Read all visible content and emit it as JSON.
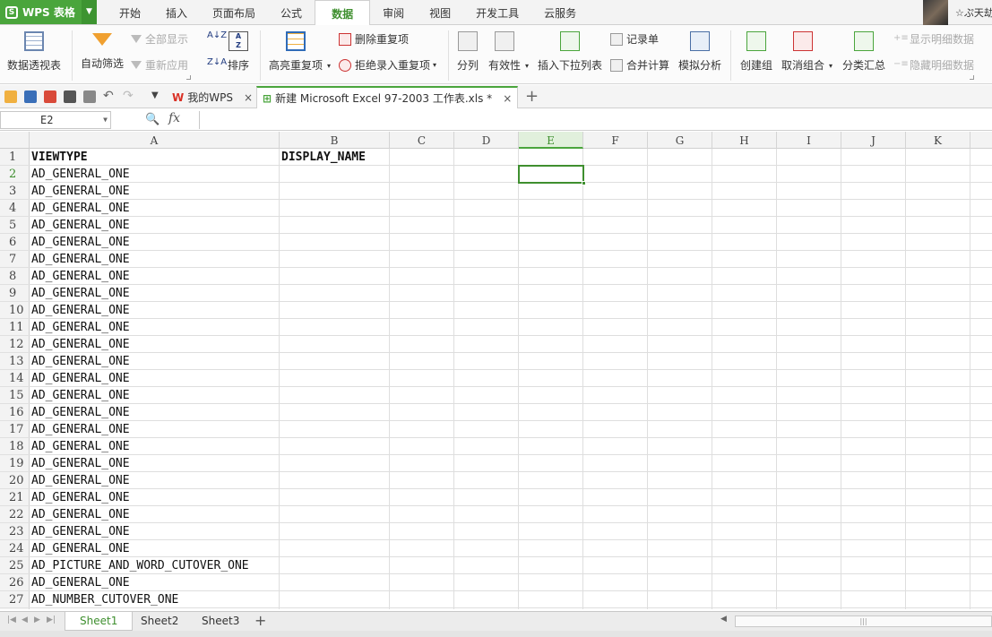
{
  "app": {
    "name": "WPS 表格",
    "logo": "S"
  },
  "menu": {
    "tabs": [
      "开始",
      "插入",
      "页面布局",
      "公式",
      "数据",
      "审阅",
      "视图",
      "开发工具",
      "云服务"
    ],
    "active": "数据"
  },
  "user": {
    "name": "☆ぷ天劫"
  },
  "ribbon": {
    "pivot": "数据透视表",
    "auto_filter": "自动筛选",
    "show_all": "全部显示",
    "reapply": "重新应用",
    "sort": "排序",
    "highlight_dup": "高亮重复项",
    "delete_dup": "删除重复项",
    "reject_dup": "拒绝录入重复项",
    "split": "分列",
    "validity": "有效性",
    "insert_dropdown": "插入下拉列表",
    "record_form": "记录单",
    "consolidate": "合并计算",
    "simulate": "模拟分析",
    "create_group": "创建组",
    "ungroup": "取消组合",
    "subtotal": "分类汇总",
    "show_detail": "显示明细数据",
    "hide_detail": "隐藏明细数据"
  },
  "doc_tabs": [
    {
      "label": "我的WPS"
    },
    {
      "label": "新建 Microsoft Excel 97-2003 工作表.xls *"
    }
  ],
  "formula_bar": {
    "cell_ref": "E2",
    "fx": "fx",
    "value": ""
  },
  "columns": [
    "A",
    "B",
    "C",
    "D",
    "E",
    "F",
    "G",
    "H",
    "I",
    "J",
    "K"
  ],
  "selected_column": "E",
  "selected_row": 2,
  "rows": [
    {
      "n": 1,
      "a": "VIEWTYPE",
      "b": "DISPLAY_NAME"
    },
    {
      "n": 2,
      "a": "AD_GENERAL_ONE",
      "b": ""
    },
    {
      "n": 3,
      "a": "AD_GENERAL_ONE",
      "b": ""
    },
    {
      "n": 4,
      "a": "AD_GENERAL_ONE",
      "b": ""
    },
    {
      "n": 5,
      "a": "AD_GENERAL_ONE",
      "b": ""
    },
    {
      "n": 6,
      "a": "AD_GENERAL_ONE",
      "b": ""
    },
    {
      "n": 7,
      "a": "AD_GENERAL_ONE",
      "b": ""
    },
    {
      "n": 8,
      "a": "AD_GENERAL_ONE",
      "b": ""
    },
    {
      "n": 9,
      "a": "AD_GENERAL_ONE",
      "b": ""
    },
    {
      "n": 10,
      "a": "AD_GENERAL_ONE",
      "b": ""
    },
    {
      "n": 11,
      "a": "AD_GENERAL_ONE",
      "b": ""
    },
    {
      "n": 12,
      "a": "AD_GENERAL_ONE",
      "b": ""
    },
    {
      "n": 13,
      "a": "AD_GENERAL_ONE",
      "b": ""
    },
    {
      "n": 14,
      "a": "AD_GENERAL_ONE",
      "b": ""
    },
    {
      "n": 15,
      "a": "AD_GENERAL_ONE",
      "b": ""
    },
    {
      "n": 16,
      "a": "AD_GENERAL_ONE",
      "b": ""
    },
    {
      "n": 17,
      "a": "AD_GENERAL_ONE",
      "b": ""
    },
    {
      "n": 18,
      "a": "AD_GENERAL_ONE",
      "b": ""
    },
    {
      "n": 19,
      "a": "AD_GENERAL_ONE",
      "b": ""
    },
    {
      "n": 20,
      "a": "AD_GENERAL_ONE",
      "b": ""
    },
    {
      "n": 21,
      "a": "AD_GENERAL_ONE",
      "b": ""
    },
    {
      "n": 22,
      "a": "AD_GENERAL_ONE",
      "b": ""
    },
    {
      "n": 23,
      "a": "AD_GENERAL_ONE",
      "b": ""
    },
    {
      "n": 24,
      "a": "AD_GENERAL_ONE",
      "b": ""
    },
    {
      "n": 25,
      "a": "AD_PICTURE_AND_WORD_CUTOVER_ONE",
      "b": ""
    },
    {
      "n": 26,
      "a": "AD_GENERAL_ONE",
      "b": ""
    },
    {
      "n": 27,
      "a": "AD_NUMBER_CUTOVER_ONE",
      "b": ""
    }
  ],
  "sheets": [
    "Sheet1",
    "Sheet2",
    "Sheet3"
  ],
  "active_sheet": "Sheet1",
  "colors": {
    "accent": "#4aa53c",
    "accent_dark": "#3f8f2f"
  }
}
